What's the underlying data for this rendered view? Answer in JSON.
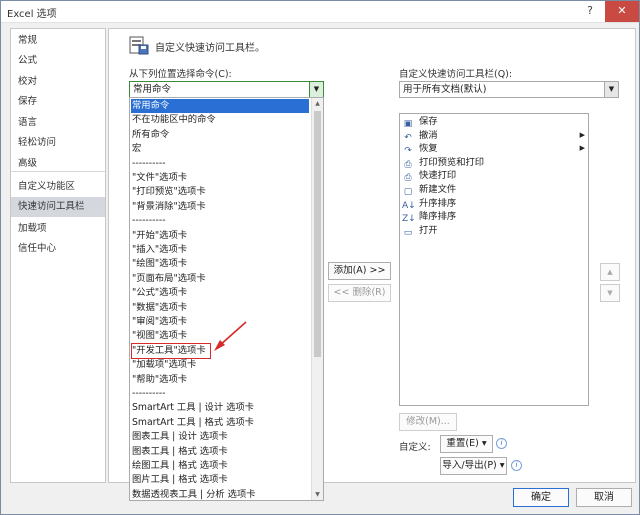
{
  "window": {
    "title": "Excel 选项",
    "help_glyph": "?",
    "close_glyph": "✕"
  },
  "nav": {
    "items": [
      {
        "label": "常规"
      },
      {
        "label": "公式"
      },
      {
        "label": "校对"
      },
      {
        "label": "保存"
      },
      {
        "label": "语言"
      },
      {
        "label": "轻松访问"
      },
      {
        "label": "高级"
      },
      {
        "label": "自定义功能区"
      },
      {
        "label": "快速访问工具栏"
      },
      {
        "label": "加载项"
      },
      {
        "label": "信任中心"
      }
    ],
    "selected_index": 8
  },
  "main": {
    "title": "自定义快速访问工具栏。",
    "choose_from_label": "从下列位置选择命令(C):",
    "choose_from_value": "常用命令",
    "customize_label": "自定义快速访问工具栏(Q):",
    "customize_value": "用于所有文档(默认)",
    "commands": [
      "常用命令",
      "不在功能区中的命令",
      "所有命令",
      "宏",
      "----------",
      "\"文件\"选项卡",
      "\"打印预览\"选项卡",
      "\"背景消除\"选项卡",
      "----------",
      "\"开始\"选项卡",
      "\"插入\"选项卡",
      "\"绘图\"选项卡",
      "\"页面布局\"选项卡",
      "\"公式\"选项卡",
      "\"数据\"选项卡",
      "\"审阅\"选项卡",
      "\"视图\"选项卡",
      "\"开发工具\"选项卡",
      "\"加载项\"选项卡",
      "\"帮助\"选项卡",
      "----------",
      "SmartArt 工具 | 设计 选项卡",
      "SmartArt 工具 | 格式 选项卡",
      "图表工具 | 设计 选项卡",
      "图表工具 | 格式 选项卡",
      "绘图工具 | 格式 选项卡",
      "图片工具 | 格式 选项卡",
      "数据透视表工具 | 分析 选项卡"
    ],
    "commands_selected_index": 0,
    "highlighted_index": 17,
    "toolbar_items": [
      {
        "label": "保存",
        "icon": "save-icon",
        "glyph": "▣",
        "submenu": false
      },
      {
        "label": "撤消",
        "icon": "undo-icon",
        "glyph": "↶",
        "submenu": true
      },
      {
        "label": "恢复",
        "icon": "redo-icon",
        "glyph": "↷",
        "submenu": true
      },
      {
        "label": "打印预览和打印",
        "icon": "print-preview-icon",
        "glyph": "⎙",
        "submenu": false
      },
      {
        "label": "快速打印",
        "icon": "quick-print-icon",
        "glyph": "⎙",
        "submenu": false
      },
      {
        "label": "新建文件",
        "icon": "new-file-icon",
        "glyph": "▢",
        "submenu": false
      },
      {
        "label": "升序排序",
        "icon": "sort-ascending-icon",
        "glyph": "A↓",
        "submenu": false
      },
      {
        "label": "降序排序",
        "icon": "sort-descending-icon",
        "glyph": "Z↓",
        "submenu": false
      },
      {
        "label": "打开",
        "icon": "open-folder-icon",
        "glyph": "▭",
        "submenu": false
      }
    ],
    "add_button": "添加(A) >>",
    "remove_button": "<< 删除(R)",
    "modify_button": "修改(M)...",
    "customize_label2": "自定义:",
    "reset_button": "重置(E) ▾",
    "import_export_button": "导入/导出(P) ▾",
    "info_glyph": "i",
    "move_up_glyph": "▲",
    "move_down_glyph": "▼"
  },
  "footer": {
    "ok": "确定",
    "cancel": "取消"
  },
  "colors": {
    "selection": "#2a6fd3",
    "highlight_box": "#d62b2b",
    "close_button": "#c94a42"
  }
}
